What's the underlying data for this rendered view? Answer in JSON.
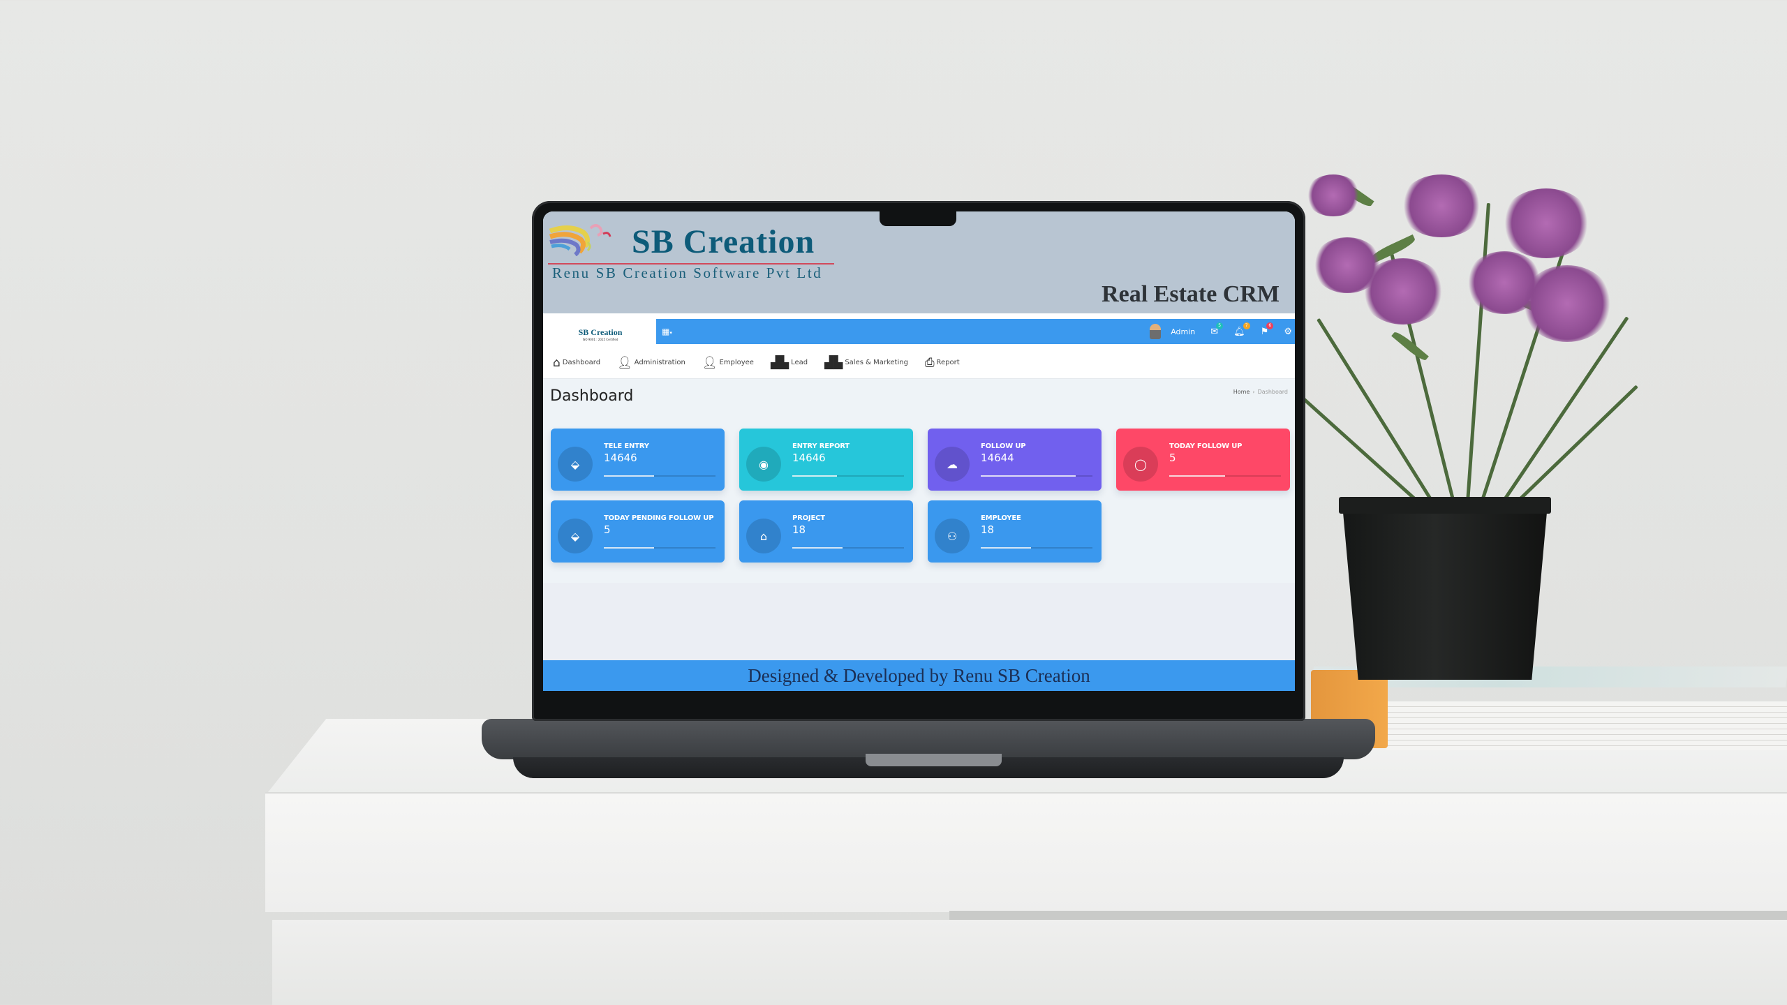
{
  "banner": {
    "brand_name": "SB Creation",
    "brand_subtitle": "Renu SB Creation Software Pvt Ltd",
    "product_title": "Real Estate CRM"
  },
  "app": {
    "mini_logo_name": "SB Creation",
    "mini_logo_tagline": "ISO 9001 : 2015 Certified",
    "topbar": {
      "grid_toggle_icon": "grid-icon",
      "user_name": "Admin",
      "mail_badge": "5",
      "notification_badge": "7",
      "flag_badge": "6"
    },
    "nav": [
      {
        "label": "Dashboard",
        "icon": "home-icon"
      },
      {
        "label": "Administration",
        "icon": "user-icon"
      },
      {
        "label": "Employee",
        "icon": "user-icon"
      },
      {
        "label": "Lead",
        "icon": "boxes-icon"
      },
      {
        "label": "Sales & Marketing",
        "icon": "boxes-icon"
      },
      {
        "label": "Report",
        "icon": "printer-icon"
      }
    ],
    "page_title": "Dashboard",
    "breadcrumb": {
      "home": "Home",
      "current": "Dashboard"
    },
    "cards": [
      {
        "label": "TELE ENTRY",
        "value": "14646",
        "icon": "tag-icon",
        "color": "#3a98ee",
        "progress": 0.45
      },
      {
        "label": "ENTRY REPORT",
        "value": "14646",
        "icon": "eye-icon",
        "color": "#26c6da",
        "progress": 0.4
      },
      {
        "label": "FOLLOW UP",
        "value": "14644",
        "icon": "cloud-download-icon",
        "color": "#7160ee",
        "progress": 0.85
      },
      {
        "label": "TODAY FOLLOW UP",
        "value": "5",
        "icon": "chat-icon",
        "color": "#fe4867",
        "progress": 0.5
      },
      {
        "label": "TODAY PENDING FOLLOW UP",
        "value": "5",
        "icon": "tag-icon",
        "color": "#3a98ee",
        "progress": 0.45
      },
      {
        "label": "PROJECT",
        "value": "18",
        "icon": "house-icon",
        "color": "#3a98ee",
        "progress": 0.45
      },
      {
        "label": "EMPLOYEE",
        "value": "18",
        "icon": "users-icon",
        "color": "#3a98ee",
        "progress": 0.45
      }
    ],
    "footer": "Designed & Developed by Renu SB Creation"
  }
}
